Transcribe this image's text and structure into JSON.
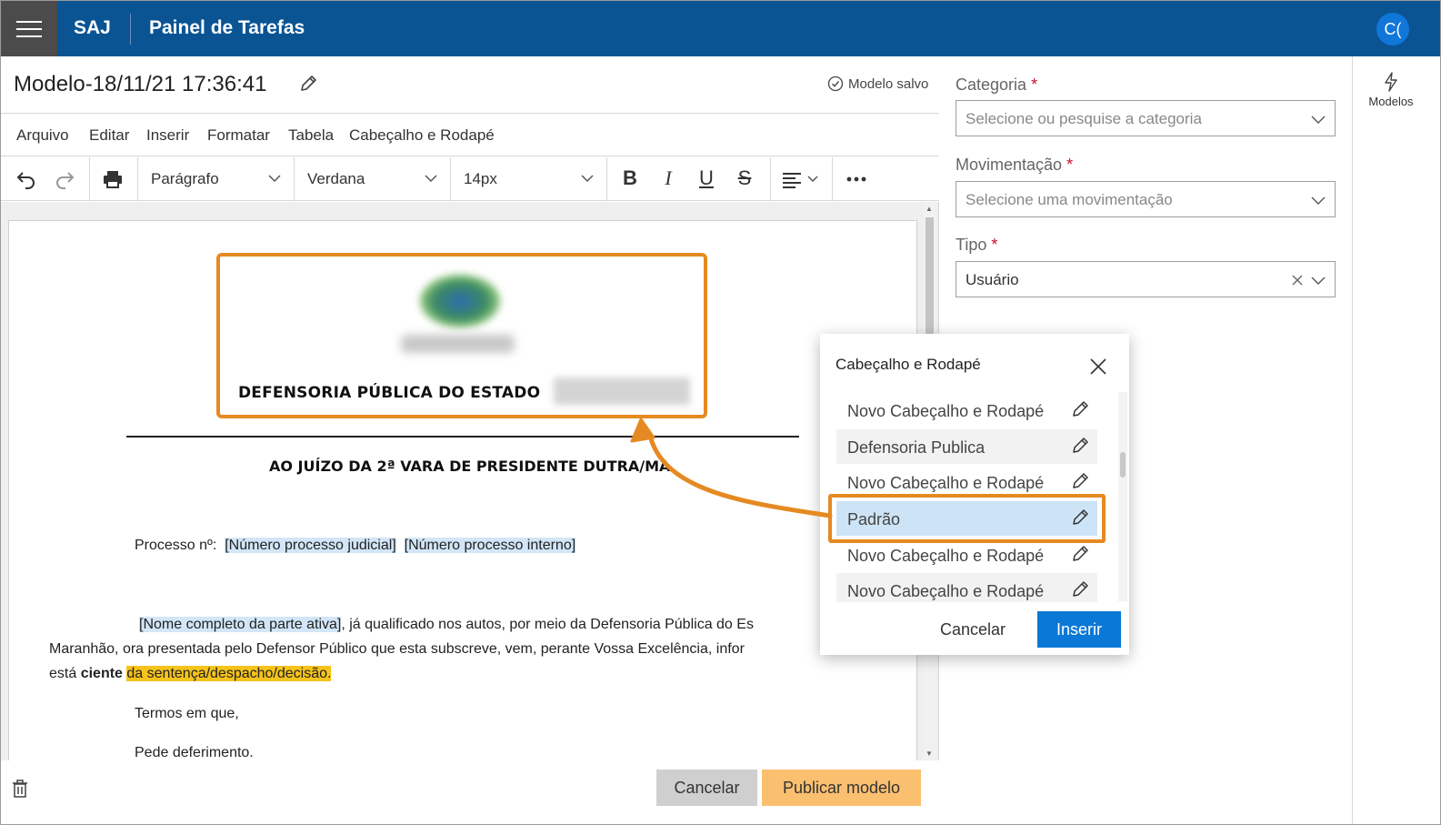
{
  "topbar": {
    "app_name": "SAJ",
    "page_name": "Painel de Tarefas",
    "avatar_initials": "C("
  },
  "document": {
    "title": "Modelo-18/11/21 17:36:41",
    "save_status": "Modelo salvo"
  },
  "menu": [
    "Arquivo",
    "Editar",
    "Inserir",
    "Formatar",
    "Tabela",
    "Cabeçalho e Rodapé"
  ],
  "toolbar": {
    "paragraph": "Parágrafo",
    "font": "Verdana",
    "size": "14px",
    "bold": "B",
    "italic": "I",
    "underline": "U",
    "strike": "S"
  },
  "page": {
    "header_title": "DEFENSORIA PÚBLICA DO ESTADO",
    "court_line": "AO JUÍZO DA 2ª VARA DE PRESIDENTE DUTRA/MA",
    "process_label": "Processo nº:",
    "placeholder_judicial": "[Número processo judicial]",
    "placeholder_internal": "[Número processo interno]",
    "placeholder_party": "[Nome completo da parte ativa]",
    "para1_rest": ", já qualificado nos autos, por meio da Defensoria Pública do Es",
    "para2": "Maranhão, ora presentada pelo Defensor Público que esta subscreve, vem, perante Vossa Excelência, infor",
    "para3_start": "está",
    "para3_bold": "ciente",
    "para3_highlight": "da sentença/despacho/decisão.",
    "closing1": "Termos em que,",
    "closing2": "Pede deferimento."
  },
  "footer": {
    "cancel": "Cancelar",
    "publish": "Publicar modelo"
  },
  "form": {
    "categoria_label": "Categoria",
    "categoria_placeholder": "Selecione ou pesquise a categoria",
    "movimentacao_label": "Movimentação",
    "movimentacao_placeholder": "Selecione uma movimentação",
    "tipo_label": "Tipo",
    "tipo_value": "Usuário",
    "required_mark": "*"
  },
  "sidebar": {
    "models_label": "Modelos"
  },
  "dialog": {
    "title": "Cabeçalho e Rodapé",
    "items": [
      "Novo Cabeçalho e Rodapé",
      "Defensoria Publica",
      "Novo Cabeçalho e Rodapé",
      "Padrão",
      "Novo Cabeçalho e Rodapé",
      "Novo Cabeçalho e Rodapé"
    ],
    "selected_index": 3,
    "cancel": "Cancelar",
    "insert": "Inserir"
  },
  "colors": {
    "topbar": "#0a5494",
    "accent_orange": "#e58a22",
    "primary_blue": "#0a78d7",
    "publish_button": "#fbbf70",
    "selected_item": "#cde4f7"
  }
}
